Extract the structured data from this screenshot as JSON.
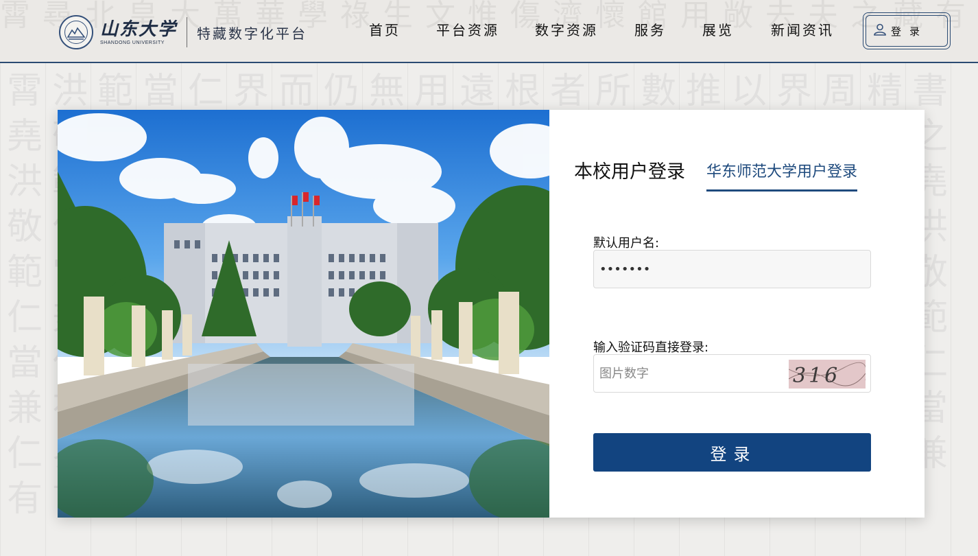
{
  "header": {
    "university_cn": "山东大学",
    "university_en": "SHANDONG UNIVERSITY",
    "platform_title": "特藏数字化平台",
    "nav": [
      {
        "label": "首页"
      },
      {
        "label": "平台资源"
      },
      {
        "label": "数字资源"
      },
      {
        "label": "服务"
      },
      {
        "label": "展览"
      },
      {
        "label": "新闻资讯"
      }
    ],
    "login_label": "登录",
    "login_icon": "user-icon"
  },
  "login": {
    "tab_local": "本校用户登录",
    "tab_other": "华东师范大学用户登录",
    "username_label": "默认用户名:",
    "username_value": "•••••••",
    "captcha_label": "输入验证码直接登录:",
    "captcha_placeholder": "图片数字",
    "captcha_text": "316",
    "submit_label": "登录"
  },
  "colors": {
    "accent": "#124480",
    "tab_active": "#1e4a7d",
    "header_border": "#2a4a72"
  }
}
